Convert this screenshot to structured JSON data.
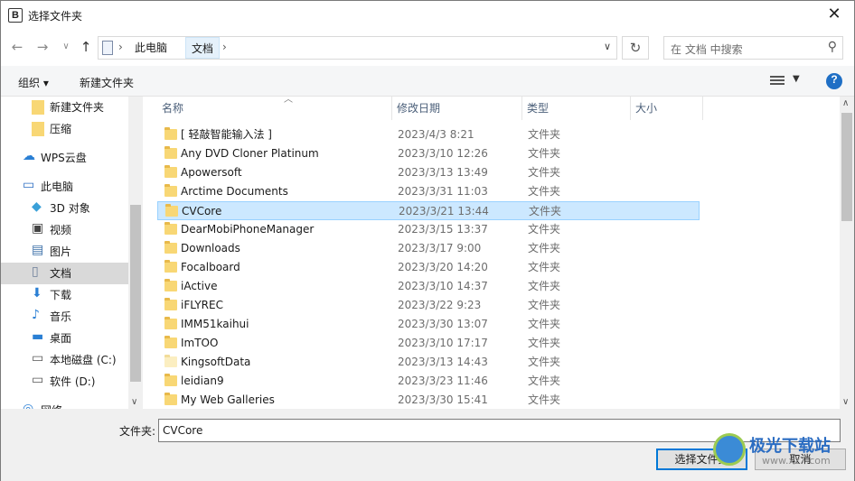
{
  "window": {
    "title": "选择文件夹",
    "app_icon": "B",
    "close": "✕"
  },
  "nav": {
    "back": "←",
    "forward": "→",
    "recent": "∨",
    "up": "↑"
  },
  "address": {
    "crumbs": [
      "此电脑",
      "文档"
    ],
    "separator": "›",
    "refresh": "↻"
  },
  "search": {
    "placeholder": "在 文档 中搜索"
  },
  "toolbar": {
    "organize": "组织 ▾",
    "new_folder": "新建文件夹",
    "help": "?"
  },
  "sidebar": {
    "items": [
      {
        "label": "新建文件夹",
        "icon": "folder-icon"
      },
      {
        "label": "压缩",
        "icon": "folder-icon"
      },
      {
        "label": "WPS云盘",
        "icon": "cloud-icon"
      },
      {
        "label": "此电脑",
        "icon": "computer-icon"
      },
      {
        "label": "3D 对象",
        "icon": "cube-icon"
      },
      {
        "label": "视频",
        "icon": "video-icon"
      },
      {
        "label": "图片",
        "icon": "picture-icon"
      },
      {
        "label": "文档",
        "icon": "document-icon",
        "selected": true
      },
      {
        "label": "下载",
        "icon": "download-icon"
      },
      {
        "label": "音乐",
        "icon": "music-icon"
      },
      {
        "label": "桌面",
        "icon": "desktop-icon"
      },
      {
        "label": "本地磁盘 (C:)",
        "icon": "drive-icon"
      },
      {
        "label": "软件 (D:)",
        "icon": "drive-icon"
      },
      {
        "label": "网络",
        "icon": "network-icon"
      }
    ]
  },
  "columns": {
    "name": "名称",
    "modified": "修改日期",
    "type": "类型",
    "size": "大小"
  },
  "files": [
    {
      "name": "[ 轻敲智能输入法 ]",
      "modified": "2023/4/3 8:21",
      "type": "文件夹"
    },
    {
      "name": "Any DVD Cloner Platinum",
      "modified": "2023/3/10 12:26",
      "type": "文件夹"
    },
    {
      "name": "Apowersoft",
      "modified": "2023/3/13 13:49",
      "type": "文件夹"
    },
    {
      "name": "Arctime Documents",
      "modified": "2023/3/31 11:03",
      "type": "文件夹"
    },
    {
      "name": "CVCore",
      "modified": "2023/3/21 13:44",
      "type": "文件夹",
      "selected": true
    },
    {
      "name": "DearMobiPhoneManager",
      "modified": "2023/3/15 13:37",
      "type": "文件夹"
    },
    {
      "name": "Downloads",
      "modified": "2023/3/17 9:00",
      "type": "文件夹"
    },
    {
      "name": "Focalboard",
      "modified": "2023/3/20 14:20",
      "type": "文件夹"
    },
    {
      "name": "iActive",
      "modified": "2023/3/10 14:37",
      "type": "文件夹"
    },
    {
      "name": "iFLYREC",
      "modified": "2023/3/22 9:23",
      "type": "文件夹"
    },
    {
      "name": "IMM51kaihui",
      "modified": "2023/3/30 13:07",
      "type": "文件夹"
    },
    {
      "name": "ImTOO",
      "modified": "2023/3/10 17:17",
      "type": "文件夹"
    },
    {
      "name": "KingsoftData",
      "modified": "2023/3/13 14:43",
      "type": "文件夹",
      "pale": true
    },
    {
      "name": "leidian9",
      "modified": "2023/3/23 11:46",
      "type": "文件夹"
    },
    {
      "name": "My Web Galleries",
      "modified": "2023/3/30 15:41",
      "type": "文件夹"
    }
  ],
  "footer": {
    "folder_label": "文件夹:",
    "folder_value": "CVCore",
    "select_button": "选择文件夹",
    "cancel_button": "取消"
  },
  "watermark": {
    "text": "极光下载站",
    "url": "www.xz7.com"
  },
  "colors": {
    "selection": "#cce8ff",
    "accent": "#0078d7",
    "folder": "#f8d775"
  }
}
